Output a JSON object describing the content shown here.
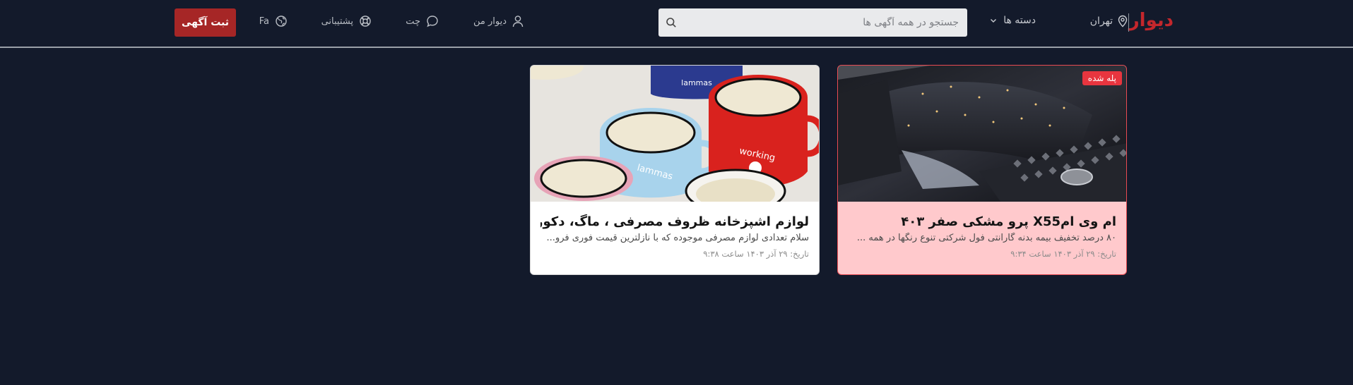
{
  "header": {
    "logo": "دیوار",
    "city": "تهران",
    "categories_label": "دسته ها",
    "search": {
      "placeholder": "جستجو در همه آگهی ها"
    },
    "my_divar": "دیوار من",
    "chat": "چت",
    "support": "پشتیبانی",
    "language": "Fa",
    "post_button": "ثبت آگهی"
  },
  "listings": [
    {
      "title": "ام وی امX55 پرو مشکی صفر ۴۰۳",
      "description": "۸۰ درصد تخفیف بیمه بدنه گارانتی فول شرکتی تنوع رنگها در همه ...",
      "date": "تاریخ: ۲۹ آذر ۱۴۰۳ ساعت ۹:۳۴",
      "badge": "پله شده",
      "highlighted": true,
      "image": "black-suv-photo"
    },
    {
      "title": "لوازم اشپزخانه ظروف مصرفی ، ماگ، دکوری و کادویی",
      "description": "سلام تعدادی لوازم مصرفی موجوده که با نازلترین قیمت فوری فرو...",
      "date": "تاریخ: ۲۹ آذر ۱۴۰۳ ساعت ۹:۳۸",
      "highlighted": false,
      "image": "colorful-mugs-photo",
      "image_texts": [
        "lammas",
        "working",
        "lammas"
      ]
    }
  ],
  "colors": {
    "background": "#131a2b",
    "brand_red": "#c3272c",
    "post_button": "#a62626",
    "highlight_card": "#ffc9cc",
    "badge": "#e8353f"
  }
}
